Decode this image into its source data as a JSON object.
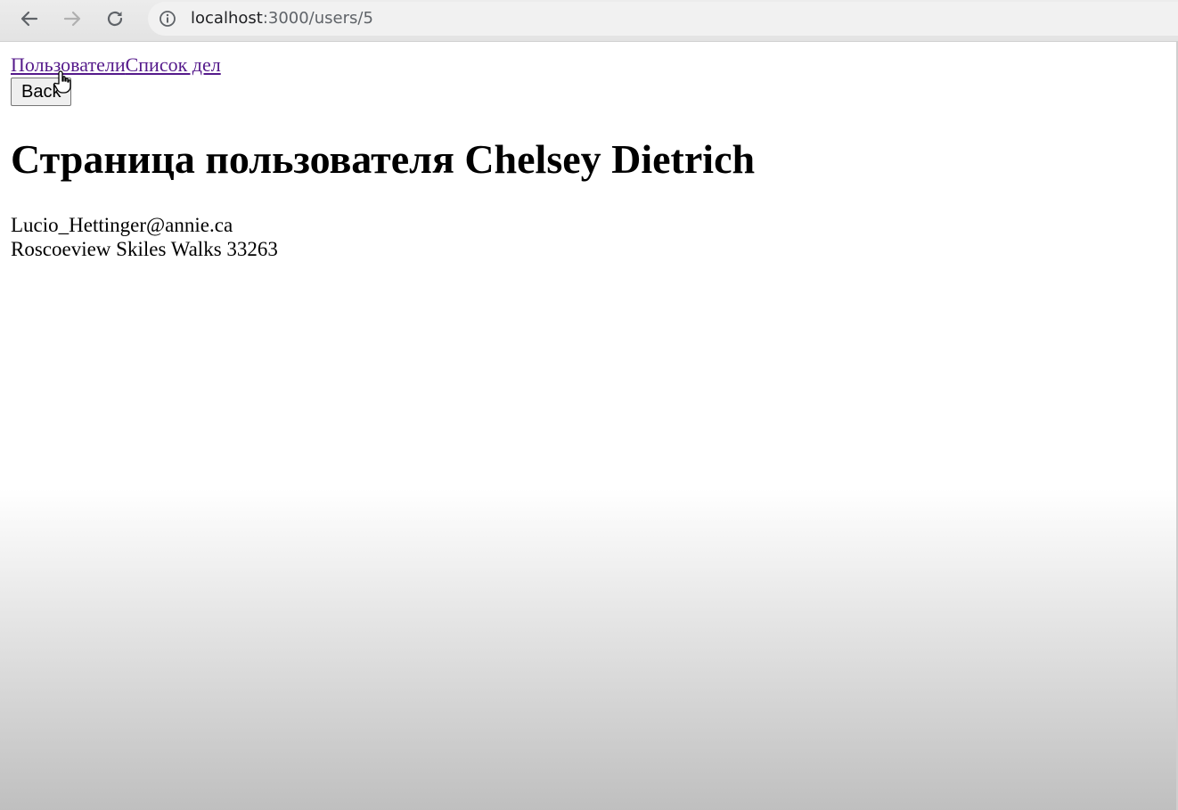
{
  "browser": {
    "url_host": "localhost",
    "url_path": ":3000/users/5",
    "icons": [
      "back-arrow-icon",
      "forward-arrow-icon",
      "reload-icon",
      "info-icon"
    ]
  },
  "page": {
    "nav": {
      "users_link": "Пользователи",
      "todos_link": "Список дел"
    },
    "back_button": "Back",
    "title": "Страница пользователя Chelsey Dietrich",
    "email": "Lucio_Hettinger@annie.ca",
    "address": "Roscoeview Skiles Walks 33263"
  }
}
